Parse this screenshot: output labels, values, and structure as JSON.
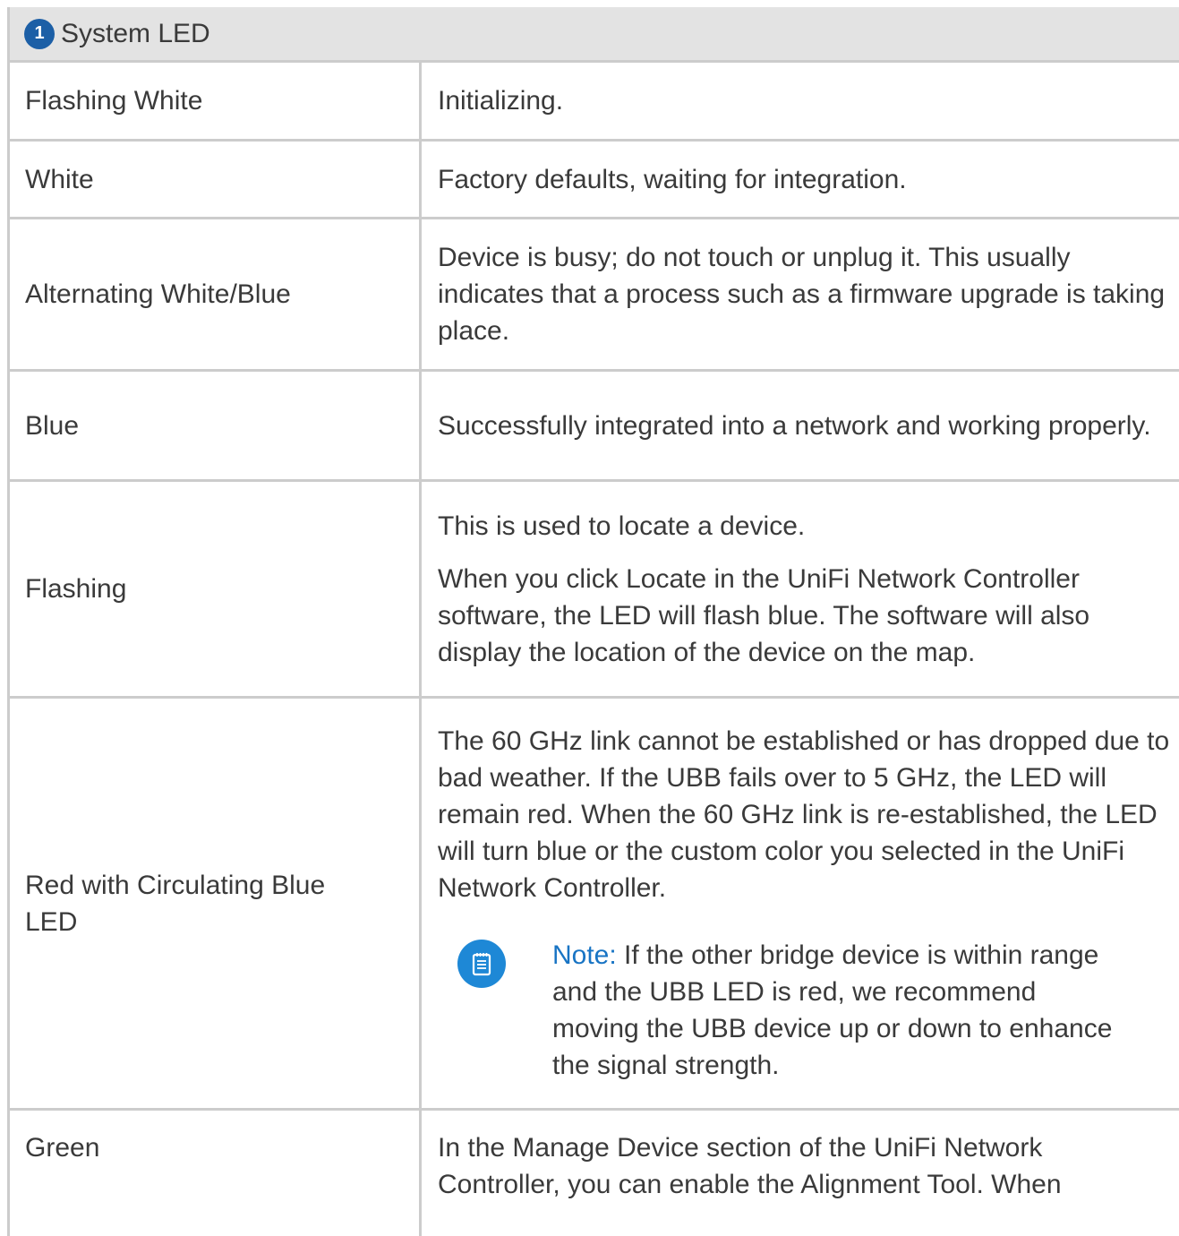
{
  "header": {
    "callout_number": "1",
    "title": "System LED"
  },
  "rows": [
    {
      "status": "Flashing White",
      "description": [
        "Initializing."
      ]
    },
    {
      "status": "White",
      "description": [
        "Factory defaults, waiting for integration."
      ]
    },
    {
      "status": "Alternating White/Blue",
      "description": [
        "Device is busy; do not touch or unplug it. This usually indicates that a process such as a firmware upgrade is taking place."
      ]
    },
    {
      "status": "Blue",
      "description": [
        "Successfully integrated into a network and working properly."
      ]
    },
    {
      "status": "Flashing",
      "description": [
        "This is used to locate a device.",
        "When you click Locate in the UniFi Network Controller software, the LED will flash blue. The software will also display the location of the device on the map."
      ]
    },
    {
      "status": "Red with Circulating Blue LED",
      "description": [
        "The 60 GHz link cannot be established or has dropped due to bad weather. If the UBB fails over to 5 GHz, the LED will remain red. When the 60 GHz link is re-established, the LED will turn blue or the custom color you selected in the UniFi Network Controller."
      ],
      "note": {
        "icon": "note-icon",
        "label": "Note:",
        "text": " If the other bridge device is within range and the UBB LED is red, we recommend moving the UBB device up or down to enhance the signal strength."
      }
    },
    {
      "status": "Green",
      "description": [
        "In the Manage Device section of the UniFi Network Controller, you can enable the Alignment Tool. When"
      ]
    }
  ],
  "colors": {
    "header_bg": "#e3e3e3",
    "border": "#cccccc",
    "callout_badge": "#1c5fa6",
    "note_icon": "#1e88d6",
    "note_label": "#1874c4",
    "text": "#3a3a3a"
  }
}
